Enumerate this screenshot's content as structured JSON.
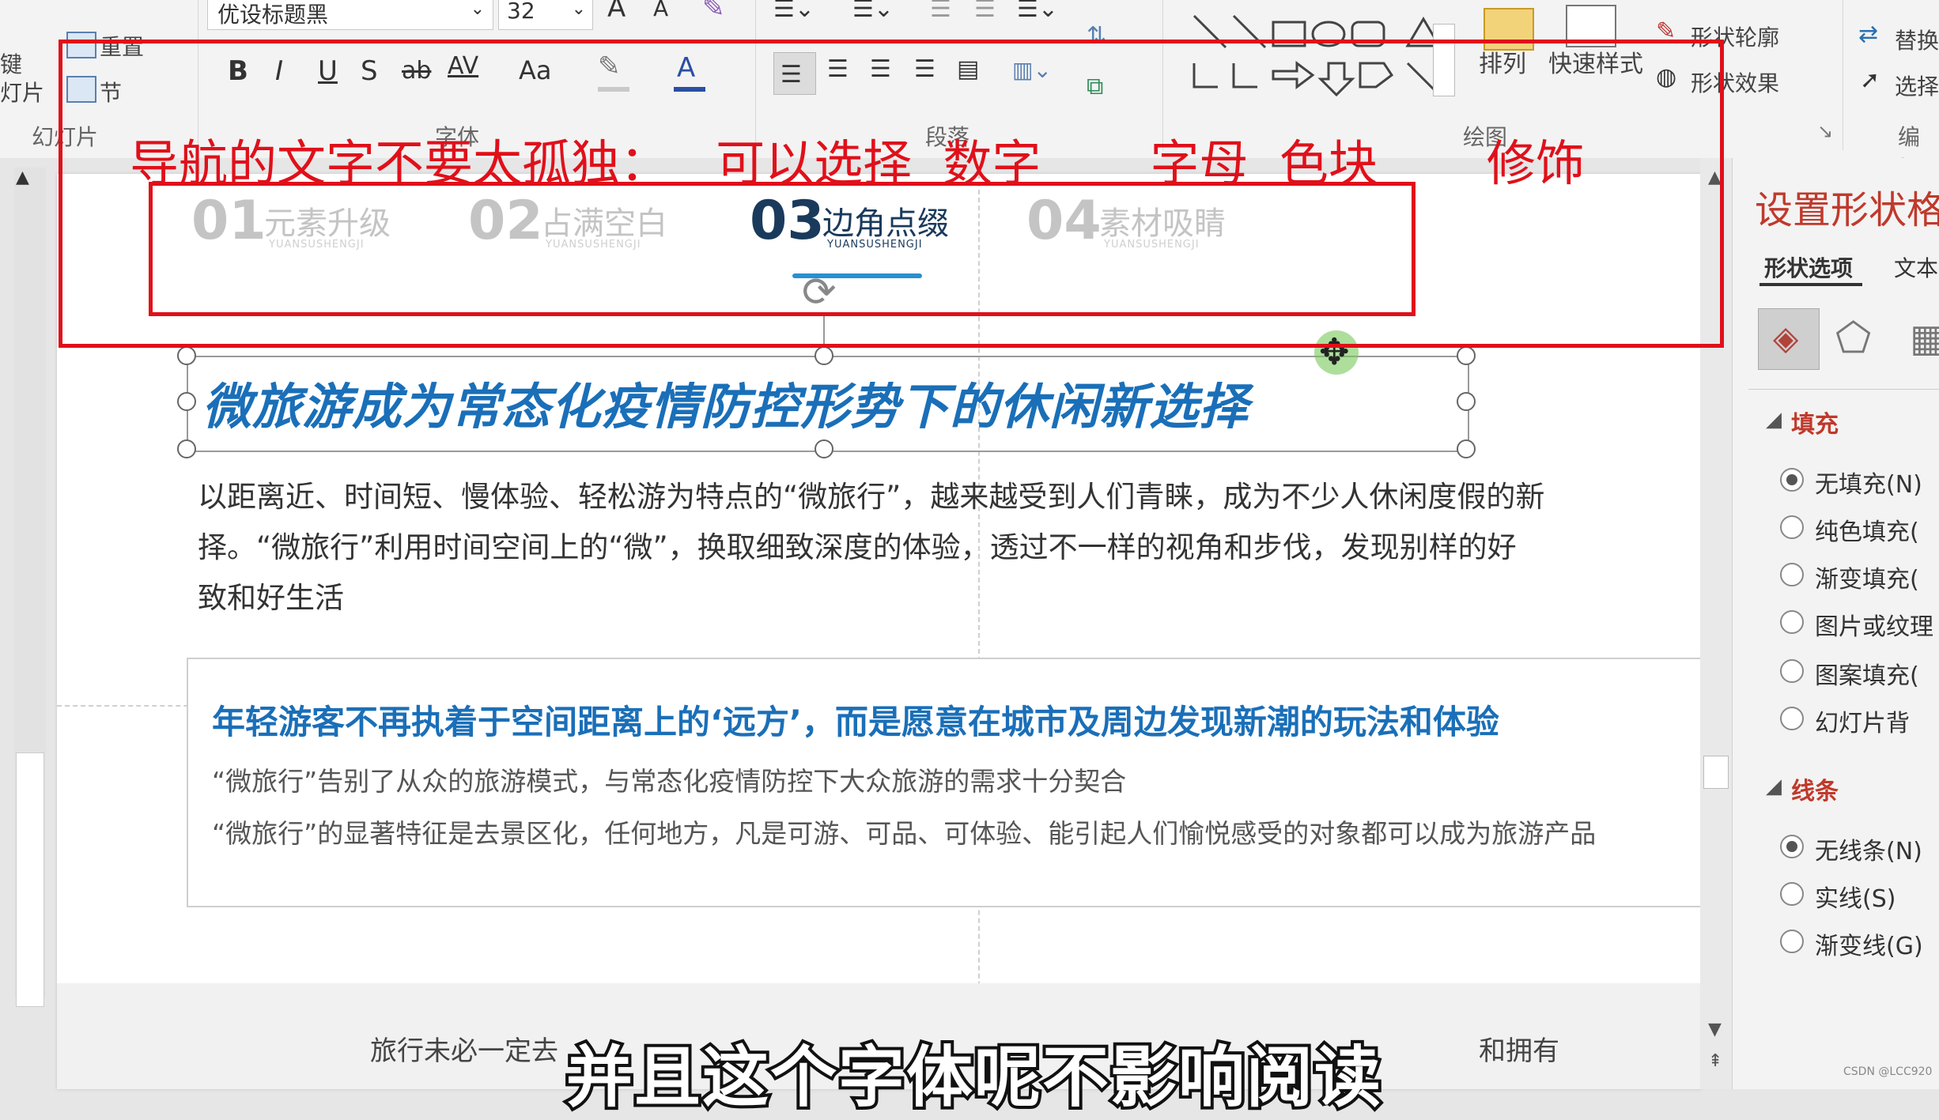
{
  "ribbon": {
    "left": {
      "new_slide_partial": "键",
      "slide_partial": "灯片",
      "reset": "重置",
      "section": "节",
      "group_slides": "幻灯片"
    },
    "font": {
      "name": "优设标题黑",
      "size": "32",
      "group_label": "字体",
      "bold": "B",
      "italic": "I",
      "underline": "U",
      "shadow": "S",
      "strike": "ab",
      "spacing": "AV",
      "case": "Aa",
      "grow": "A",
      "shrink": "A"
    },
    "paragraph": {
      "group_label": "段落"
    },
    "drawing": {
      "arrange": "排列",
      "quick_styles": "快速样式",
      "shape_outline": "形状轮廓",
      "shape_effects": "形状效果",
      "group_label": "绘图"
    },
    "editing": {
      "replace": "替换",
      "select": "选择",
      "group_label": "编辑"
    }
  },
  "annotation": {
    "caption": "导航的文字不要太孤独：   可以选择  数字       字母  色块       修饰"
  },
  "nav": [
    {
      "num": "01",
      "title": "元素升级",
      "sub": "YUANSUSHENGJI",
      "active": false
    },
    {
      "num": "02",
      "title": "占满空白",
      "sub": "YUANSUSHENGJI",
      "active": false
    },
    {
      "num": "03",
      "title": "边角点缀",
      "sub": "YUANSUSHENGJI",
      "active": true
    },
    {
      "num": "04",
      "title": "素材吸睛",
      "sub": "YUANSUSHENGJI",
      "active": false
    }
  ],
  "slide": {
    "heading": "微旅游成为常态化疫情防控形势下的休闲新选择",
    "body_line1": "以距离近、时间短、慢体验、轻松游为特点的“微旅行”，越来越受到人们青睐，成为不少人休闲度假的新",
    "body_line2": "择。“微旅行”利用时间空间上的“微”，换取细致深度的体验，透过不一样的视角和步伐，发现别样的好",
    "body_line3": "致和好生活",
    "box_heading": "年轻游客不再执着于空间距离上的‘远方’，而是愿意在城市及周边发现新潮的玩法和体验",
    "box_line1": "“微旅行”告别了从众的旅游模式，与常态化疫情防控下大众旅游的需求十分契合",
    "box_line2": "“微旅行”的显著特征是去景区化，任何地方，凡是可游、可品、可体验、能引起人们愉悦感受的对象都可以成为旅游产品",
    "footer_left": "旅行未必一定去",
    "footer_right": "和拥有",
    "subtitle": "并且这个字体呢不影响阅读"
  },
  "pane": {
    "title": "设置形状格",
    "tab_shape": "形状选项",
    "tab_text": "文本",
    "fill_header": "填充",
    "fill_options": [
      "无填充(N)",
      "纯色填充(",
      "渐变填充(",
      "图片或纹理",
      "图案填充(",
      "幻灯片背"
    ],
    "line_header": "线条",
    "line_options": [
      "无线条(N)",
      "实线(S)",
      "渐变线(G)"
    ],
    "watermark": "CSDN @LCC920"
  },
  "colors": {
    "accent_red": "#e0101a",
    "heading_blue": "#1a6fb8",
    "nav_active": "#1a3a5c",
    "nav_underline": "#2a8fd0",
    "pane_red": "#c0392b"
  }
}
